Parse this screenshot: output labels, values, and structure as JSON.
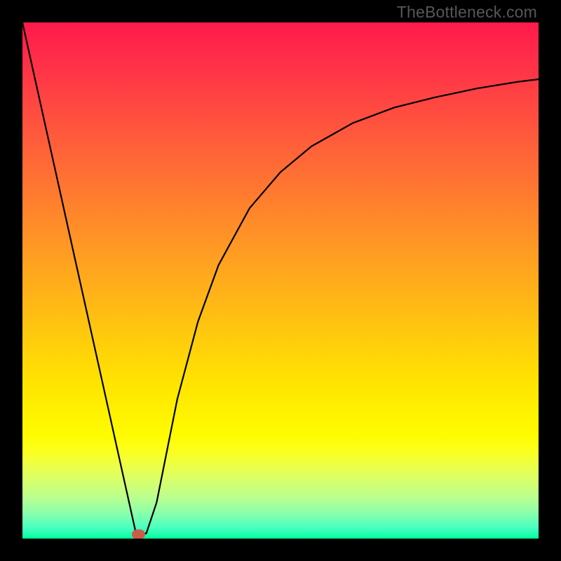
{
  "watermark": "TheBottleneck.com",
  "chart_data": {
    "type": "line",
    "title": "",
    "xlabel": "",
    "ylabel": "",
    "xlim": [
      0,
      100
    ],
    "ylim": [
      0,
      100
    ],
    "series": [
      {
        "name": "curve",
        "x": [
          0,
          5,
          10,
          15,
          20,
          22,
          24,
          26,
          28,
          30,
          34,
          38,
          44,
          50,
          56,
          64,
          72,
          80,
          88,
          96,
          100
        ],
        "y": [
          100,
          77.5,
          55,
          32.5,
          10,
          1,
          1,
          7,
          17,
          27,
          42,
          53,
          64,
          71,
          76,
          80.5,
          83.5,
          85.5,
          87.2,
          88.5,
          89
        ]
      }
    ],
    "marker": {
      "x": 22.5,
      "y": 0.8,
      "color": "#cc5b47"
    },
    "gradient_stops": [
      {
        "pos": 0,
        "color": "#ff1a4b"
      },
      {
        "pos": 80,
        "color": "#fffc00"
      },
      {
        "pos": 100,
        "color": "#00ff9c"
      }
    ]
  }
}
